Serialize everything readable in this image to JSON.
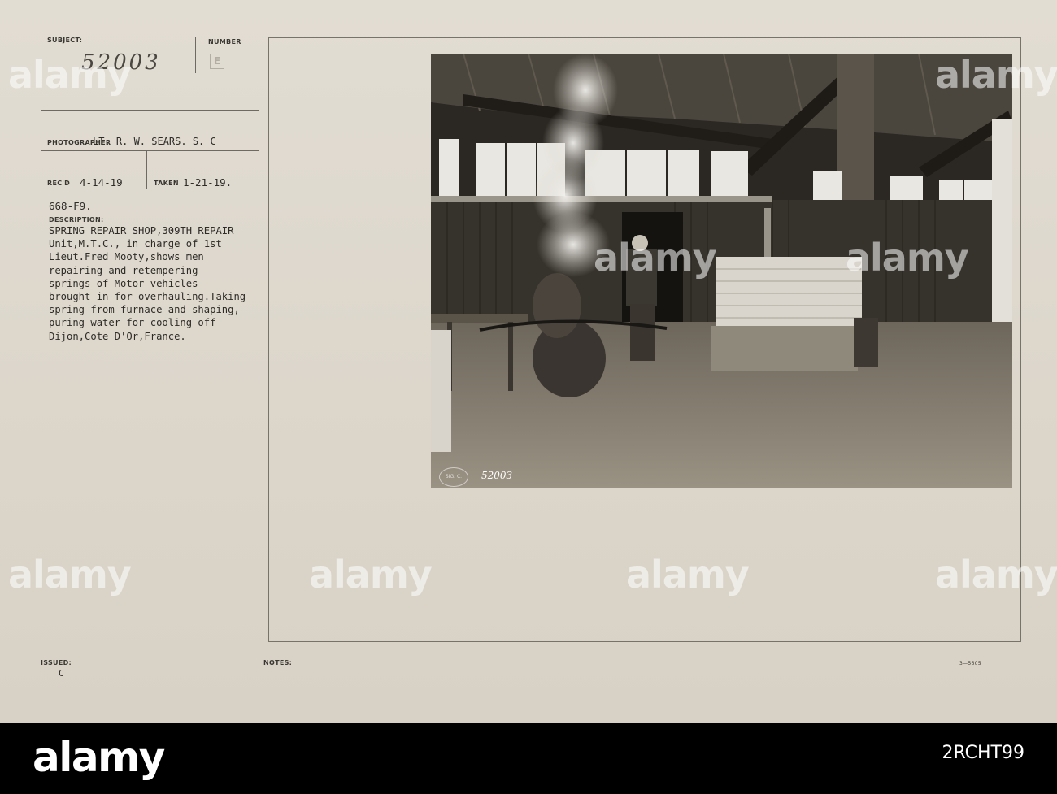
{
  "card": {
    "subject_label": "SUBJECT:",
    "subject_number": "52003",
    "number_label": "NUMBER",
    "number_stamp": "E",
    "photographer_label": "PHOTOGRAPHER",
    "photographer_value": "LT. R. W. SEARS. S. C",
    "recd_label": "REC'D",
    "recd_value": "4-14-19",
    "taken_label": "TAKEN",
    "taken_value": "1-21-19.",
    "file_code": "668-F9.",
    "description_label": "DESCRIPTION:",
    "description_lines": [
      "SPRING REPAIR SHOP,309TH REPAIR",
      "Unit,M.T.C., in charge of 1st",
      "Lieut.Fred Mooty,shows men",
      "repairing and retempering",
      "springs of Motor vehicles",
      "brought in for overhauling.Taking",
      "spring from furnace and shaping,",
      "puring water for cooling off",
      "Dijon,Cote D'Or,France."
    ],
    "issued_label": "ISSUED:",
    "issued_value": "C",
    "notes_label": "NOTES:",
    "form_number": "3—5605"
  },
  "photo": {
    "negative_number": "52003",
    "stamp_text": "SIG. C."
  },
  "watermarks": [
    "alamy",
    "alamy",
    "alamy",
    "alamy",
    "alamy",
    "alamy",
    "alamy",
    "alamy"
  ],
  "footer": {
    "logo": "alamy",
    "image_id": "2RCHT99"
  }
}
